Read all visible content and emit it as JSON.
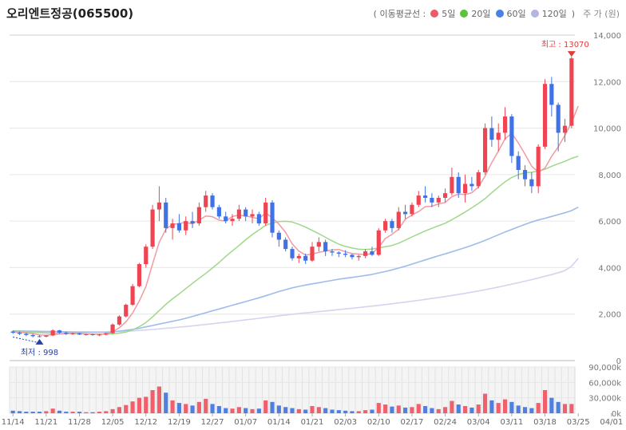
{
  "title": "오리엔트정공(065500)",
  "legend": {
    "label": "( 이동평균선  :",
    "items": [
      {
        "name": "5일",
        "color": "#f05a68"
      },
      {
        "name": "20일",
        "color": "#5fc23a"
      },
      {
        "name": "60일",
        "color": "#4a80e8"
      },
      {
        "name": "120일",
        "color": "#b3b3e6"
      }
    ],
    "close": ")",
    "unit": "주 가 (원)"
  },
  "colors": {
    "up": "#f04452",
    "down": "#3f72e6",
    "ma5": "#f29aa2",
    "ma20": "#9fd88a",
    "ma60": "#9fbbea",
    "ma120": "#d4d4ee"
  },
  "annotations": {
    "high": "최고 : 13070",
    "low": "최저 : 998"
  },
  "chart_data": {
    "type": "candlestick",
    "price_axis": {
      "min": 0,
      "max": 14000,
      "ticks": [
        0,
        2000,
        4000,
        6000,
        8000,
        10000,
        12000,
        14000
      ],
      "labels": [
        "0",
        "2,000",
        "4,000",
        "6,000",
        "8,000",
        "10,000",
        "12,000",
        "14,000"
      ]
    },
    "volume_axis": {
      "max": 90000,
      "ticks": [
        0,
        30000,
        60000,
        90000
      ],
      "labels": [
        "0k",
        "30,000k",
        "60,000k",
        "90,000k"
      ]
    },
    "x_tick_labels": [
      "11/14",
      "11/21",
      "11/28",
      "12/05",
      "12/12",
      "12/19",
      "12/27",
      "01/07",
      "01/14",
      "01/21",
      "02/03",
      "02/10",
      "02/17",
      "02/24",
      "03/04",
      "03/11",
      "03/18",
      "03/25",
      "04/01"
    ],
    "x_tick_index": [
      0,
      5,
      10,
      15,
      20,
      25,
      30,
      35,
      40,
      45,
      50,
      55,
      60,
      65,
      70,
      75,
      80,
      85,
      90
    ],
    "candles": [
      [
        1250,
        1300,
        1150,
        1200,
        5
      ],
      [
        1200,
        1250,
        1100,
        1150,
        4
      ],
      [
        1150,
        1200,
        1050,
        1100,
        3
      ],
      [
        1100,
        1150,
        1000,
        1050,
        3
      ],
      [
        1050,
        1100,
        998,
        1030,
        3
      ],
      [
        1030,
        1100,
        1000,
        1080,
        4
      ],
      [
        1080,
        1350,
        1050,
        1300,
        9
      ],
      [
        1300,
        1320,
        1150,
        1200,
        5
      ],
      [
        1200,
        1250,
        1100,
        1150,
        3
      ],
      [
        1150,
        1200,
        1100,
        1170,
        3
      ],
      [
        1170,
        1200,
        1100,
        1120,
        3
      ],
      [
        1120,
        1150,
        1080,
        1130,
        2
      ],
      [
        1130,
        1160,
        1080,
        1100,
        2
      ],
      [
        1100,
        1150,
        1050,
        1120,
        3
      ],
      [
        1120,
        1200,
        1080,
        1180,
        4
      ],
      [
        1180,
        1600,
        1150,
        1550,
        8
      ],
      [
        1550,
        1950,
        1500,
        1900,
        12
      ],
      [
        1900,
        2450,
        1850,
        2400,
        16
      ],
      [
        2400,
        3300,
        2350,
        3200,
        23
      ],
      [
        3200,
        4200,
        3150,
        4150,
        30
      ],
      [
        4150,
        5000,
        4000,
        4900,
        32
      ],
      [
        4900,
        6700,
        4800,
        6500,
        45
      ],
      [
        6500,
        7500,
        6000,
        6800,
        52
      ],
      [
        6800,
        7000,
        5500,
        5700,
        40
      ],
      [
        5700,
        6100,
        5200,
        5900,
        25
      ],
      [
        5900,
        6300,
        5500,
        5600,
        20
      ],
      [
        5600,
        6200,
        5400,
        6000,
        18
      ],
      [
        6000,
        6400,
        5700,
        5900,
        15
      ],
      [
        5900,
        6800,
        5800,
        6600,
        22
      ],
      [
        6600,
        7300,
        6400,
        7100,
        28
      ],
      [
        7100,
        7200,
        6500,
        6600,
        18
      ],
      [
        6600,
        6700,
        6100,
        6200,
        14
      ],
      [
        6200,
        6400,
        5900,
        6000,
        10
      ],
      [
        6000,
        6300,
        5800,
        6100,
        9
      ],
      [
        6100,
        6700,
        6000,
        6500,
        12
      ],
      [
        6500,
        6600,
        6000,
        6200,
        10
      ],
      [
        6200,
        6500,
        5900,
        6300,
        8
      ],
      [
        6300,
        6400,
        5800,
        5900,
        9
      ],
      [
        5900,
        7000,
        5800,
        6800,
        25
      ],
      [
        6800,
        6900,
        5300,
        5500,
        22
      ],
      [
        5500,
        5600,
        4900,
        5200,
        15
      ],
      [
        5200,
        5300,
        4700,
        4800,
        12
      ],
      [
        4800,
        4900,
        4300,
        4400,
        10
      ],
      [
        4400,
        4600,
        4200,
        4500,
        8
      ],
      [
        4500,
        4600,
        4150,
        4300,
        7
      ],
      [
        4300,
        5100,
        4250,
        4900,
        14
      ],
      [
        4900,
        5300,
        4700,
        5100,
        12
      ],
      [
        5100,
        5200,
        4500,
        4700,
        10
      ],
      [
        4700,
        4800,
        4500,
        4650,
        7
      ],
      [
        4650,
        4700,
        4450,
        4600,
        6
      ],
      [
        4600,
        4750,
        4450,
        4550,
        5
      ],
      [
        4550,
        4600,
        4350,
        4450,
        4
      ],
      [
        4450,
        4550,
        4300,
        4500,
        4
      ],
      [
        4500,
        4800,
        4400,
        4700,
        6
      ],
      [
        4700,
        4900,
        4500,
        4550,
        7
      ],
      [
        4550,
        5700,
        4500,
        5600,
        20
      ],
      [
        5600,
        6100,
        5500,
        6000,
        17
      ],
      [
        6000,
        6100,
        5500,
        5700,
        13
      ],
      [
        5700,
        6600,
        5600,
        6400,
        15
      ],
      [
        6400,
        6700,
        6100,
        6300,
        11
      ],
      [
        6300,
        6800,
        6200,
        6700,
        12
      ],
      [
        6700,
        7300,
        6600,
        7100,
        18
      ],
      [
        7100,
        7500,
        6800,
        7000,
        14
      ],
      [
        7000,
        7200,
        6600,
        6800,
        10
      ],
      [
        6800,
        7100,
        6600,
        7000,
        8
      ],
      [
        7000,
        7400,
        6800,
        7200,
        12
      ],
      [
        7200,
        8300,
        7100,
        7900,
        24
      ],
      [
        7900,
        8100,
        7000,
        7200,
        17
      ],
      [
        7200,
        8000,
        6800,
        7600,
        14
      ],
      [
        7600,
        7900,
        7300,
        7500,
        11
      ],
      [
        7500,
        8200,
        7400,
        8100,
        17
      ],
      [
        8100,
        10200,
        8000,
        10000,
        38
      ],
      [
        10000,
        10500,
        9200,
        9500,
        25
      ],
      [
        9500,
        10200,
        9000,
        9800,
        20
      ],
      [
        9800,
        10900,
        9500,
        10500,
        27
      ],
      [
        10500,
        10600,
        8500,
        8800,
        22
      ],
      [
        8800,
        9000,
        7800,
        8200,
        15
      ],
      [
        8200,
        8400,
        7500,
        7800,
        12
      ],
      [
        7800,
        8100,
        7200,
        7500,
        10
      ],
      [
        7500,
        9300,
        7200,
        9200,
        20
      ],
      [
        9200,
        12100,
        9100,
        11900,
        45
      ],
      [
        11900,
        12200,
        10500,
        11000,
        30
      ],
      [
        11000,
        11100,
        9000,
        9800,
        22
      ],
      [
        9800,
        10400,
        9400,
        10100,
        18
      ],
      [
        10100,
        13070,
        10000,
        13000,
        18
      ]
    ],
    "ma5": [
      1250,
      1220,
      1190,
      1160,
      1110,
      1090,
      1120,
      1140,
      1160,
      1190,
      1180,
      1160,
      1140,
      1130,
      1140,
      1240,
      1410,
      1670,
      2050,
      2560,
      3190,
      4160,
      5090,
      5650,
      5860,
      5900,
      5950,
      5880,
      6040,
      6220,
      6190,
      6040,
      6000,
      6200,
      6260,
      6220,
      6160,
      6100,
      6360,
      6140,
      5870,
      5510,
      5020,
      4710,
      4540,
      4580,
      4660,
      4710,
      4760,
      4780,
      4680,
      4610,
      4580,
      4560,
      4600,
      4880,
      5250,
      5430,
      5650,
      6080,
      6260,
      6410,
      6620,
      6640,
      6740,
      6800,
      7050,
      7160,
      7140,
      7220,
      7470,
      7940,
      8520,
      9010,
      9540,
      9780,
      9360,
      8880,
      8360,
      8110,
      8280,
      8780,
      9200,
      9690,
      10240,
      10950
    ],
    "ma20": [
      1280,
      1260,
      1240,
      1220,
      1200,
      1185,
      1175,
      1165,
      1160,
      1155,
      1150,
      1145,
      1140,
      1138,
      1138,
      1150,
      1180,
      1230,
      1320,
      1460,
      1640,
      1880,
      2150,
      2420,
      2660,
      2870,
      3100,
      3320,
      3540,
      3750,
      3980,
      4220,
      4480,
      4720,
      4950,
      5200,
      5420,
      5620,
      5820,
      5920,
      5980,
      5990,
      5960,
      5860,
      5740,
      5600,
      5460,
      5300,
      5150,
      5010,
      4910,
      4840,
      4790,
      4780,
      4800,
      4850,
      4900,
      4950,
      5050,
      5180,
      5320,
      5450,
      5580,
      5690,
      5800,
      5910,
      6060,
      6220,
      6390,
      6570,
      6760,
      6970,
      7220,
      7460,
      7690,
      7880,
      8000,
      8080,
      8100,
      8150,
      8230,
      8360,
      8470,
      8570,
      8700,
      8790
    ],
    "ma60": [
      1280,
      1275,
      1270,
      1265,
      1260,
      1255,
      1250,
      1245,
      1240,
      1235,
      1230,
      1228,
      1226,
      1225,
      1225,
      1240,
      1270,
      1300,
      1340,
      1390,
      1450,
      1510,
      1570,
      1630,
      1690,
      1750,
      1820,
      1900,
      1980,
      2060,
      2140,
      2220,
      2300,
      2380,
      2460,
      2540,
      2620,
      2700,
      2790,
      2880,
      2970,
      3050,
      3130,
      3190,
      3250,
      3300,
      3350,
      3400,
      3450,
      3500,
      3540,
      3580,
      3620,
      3660,
      3710,
      3770,
      3830,
      3900,
      3980,
      4060,
      4150,
      4240,
      4330,
      4420,
      4510,
      4590,
      4680,
      4770,
      4860,
      4960,
      5060,
      5170,
      5290,
      5410,
      5530,
      5640,
      5750,
      5860,
      5960,
      6050,
      6120,
      6200,
      6280,
      6360,
      6450,
      6600
    ],
    "ma120": [
      1200,
      1202,
      1204,
      1206,
      1208,
      1210,
      1212,
      1214,
      1216,
      1218,
      1220,
      1222,
      1224,
      1226,
      1228,
      1236,
      1248,
      1262,
      1278,
      1296,
      1316,
      1338,
      1362,
      1388,
      1414,
      1440,
      1466,
      1494,
      1524,
      1554,
      1586,
      1618,
      1650,
      1684,
      1718,
      1752,
      1786,
      1820,
      1856,
      1892,
      1928,
      1962,
      1994,
      2024,
      2052,
      2080,
      2108,
      2136,
      2164,
      2192,
      2222,
      2252,
      2282,
      2312,
      2344,
      2376,
      2410,
      2444,
      2480,
      2516,
      2554,
      2592,
      2632,
      2672,
      2714,
      2756,
      2800,
      2846,
      2894,
      2944,
      2996,
      3050,
      3106,
      3164,
      3224,
      3286,
      3350,
      3416,
      3484,
      3554,
      3626,
      3700,
      3780,
      3870,
      4060,
      4400
    ]
  }
}
